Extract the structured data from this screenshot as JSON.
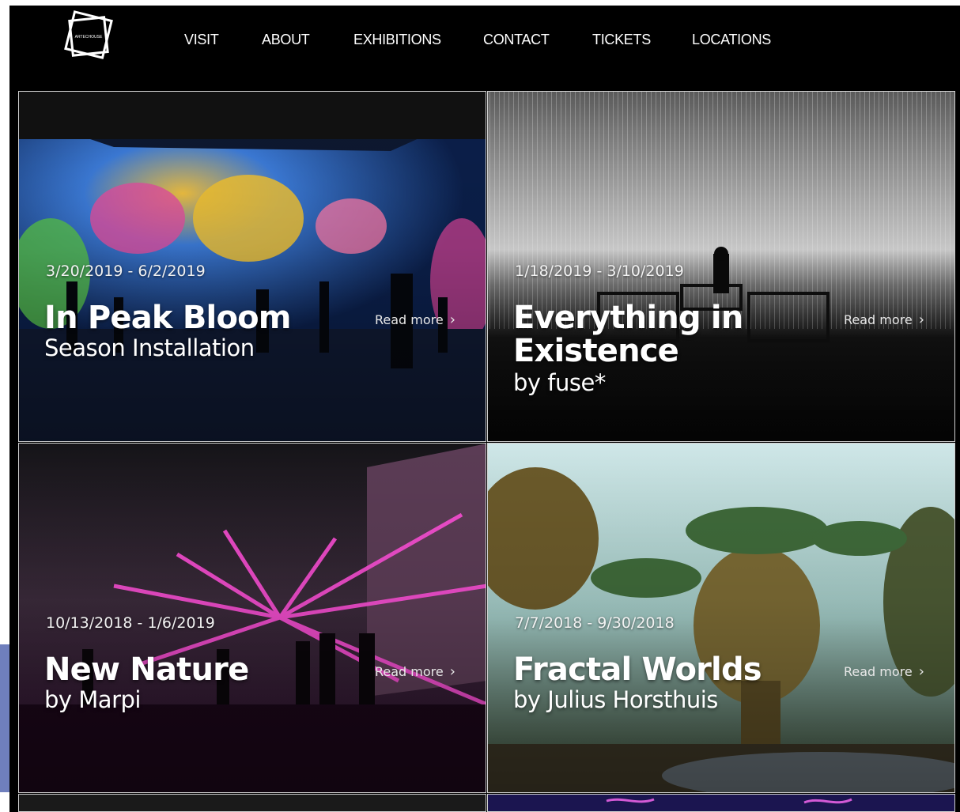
{
  "nav": {
    "logo_text": "ARTECHOUSE",
    "items": [
      "VISIT",
      "ABOUT",
      "EXHIBITIONS",
      "CONTACT",
      "TICKETS",
      "LOCATIONS"
    ]
  },
  "exhibitions": [
    {
      "dates": "3/20/2019 - 6/2/2019",
      "title": "In Peak Bloom",
      "subtitle": "Season Installation",
      "read_more": "Read more"
    },
    {
      "dates": "1/18/2019 - 3/10/2019",
      "title": "Everything in Existence",
      "subtitle": "by fuse*",
      "read_more": "Read more"
    },
    {
      "dates": "10/13/2018 - 1/6/2019",
      "title": "New Nature",
      "subtitle": "by Marpi",
      "read_more": "Read more"
    },
    {
      "dates": "7/7/2018 - 9/30/2018",
      "title": "Fractal Worlds",
      "subtitle": "by Julius Horsthuis",
      "read_more": "Read more"
    }
  ],
  "icons": {
    "read_more": "chevron-right-icon",
    "logo": "artechouse-logo"
  },
  "colors": {
    "background": "#000000",
    "text": "#ffffff",
    "side_band": "#6f7fbd"
  }
}
